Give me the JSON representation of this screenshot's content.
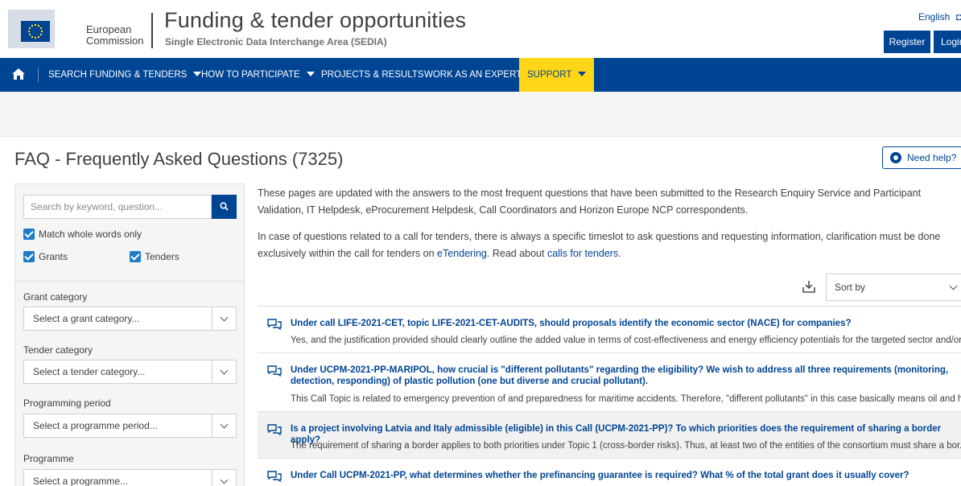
{
  "header": {
    "org_line1": "European",
    "org_line2": "Commission",
    "title": "Funding & tender opportunities",
    "subtitle": "Single Electronic Data Interchange Area (SEDIA)",
    "language": "English",
    "register_label": "Register",
    "login_label": "Login"
  },
  "nav": {
    "items": [
      {
        "label": "SEARCH FUNDING & TENDERS",
        "dropdown": true
      },
      {
        "label": "HOW TO PARTICIPATE",
        "dropdown": true
      },
      {
        "label": "PROJECTS & RESULTS",
        "dropdown": false
      },
      {
        "label": "WORK AS AN EXPERT",
        "dropdown": false
      },
      {
        "label": "SUPPORT",
        "dropdown": true,
        "highlight": "#ffd617"
      }
    ]
  },
  "page": {
    "title": "FAQ - Frequently Asked Questions (7325)",
    "need_help_label": "Need help?"
  },
  "sidebar": {
    "search_placeholder": "Search by keyword, question...",
    "match_whole_words_label": "Match whole words only",
    "grants_label": "Grants",
    "tenders_label": "Tenders",
    "filters": [
      {
        "label": "Grant category",
        "value": "Select a grant category..."
      },
      {
        "label": "Tender category",
        "value": "Select a tender category..."
      },
      {
        "label": "Programming period",
        "value": "Select a programme period..."
      },
      {
        "label": "Programme",
        "value": "Select a programme..."
      }
    ]
  },
  "intro": {
    "p1": "These pages are updated with the answers to the most frequent questions that have been submitted to the Research Enquiry Service and Participant Validation, IT Helpdesk, eProcurement Helpdesk, Call Coordinators and Horizon Europe NCP correspondents.",
    "p2_before": "In case of questions related to a call for tenders, there is always a specific timeslot to ask questions and requesting information, clarification must be done exclusively within the call for tenders on ",
    "p2_link1": "eTendering",
    "p2_middle": ". Read about ",
    "p2_link2": "calls for tenders",
    "p2_after": "."
  },
  "sort": {
    "label": "Sort by"
  },
  "faqs": [
    {
      "question": "Under call LIFE-2021-CET, topic LIFE-2021-CET-AUDITS, should proposals identify the economic sector (NACE) for companies?",
      "answer": "Yes, and the justification provided should clearly outline the added value in terms of cost-effectiveness and energy efficiency potentials for the targeted sector and/or ..."
    },
    {
      "question": "Under UCPM-2021-PP-MARIPOL, how crucial is \"different pollutants\" regarding the eligibility? We wish to address all three requirements (monitoring, detection, responding) of plastic pollution (one but diverse and crucial pollutant).",
      "answer": "This Call Topic is related to emergency prevention of and preparedness for maritime accidents. Therefore, \"different pollutants\" in this case basically means oil and h..."
    },
    {
      "question": "Is a project involving Latvia and Italy admissible (eligible) in this Call (UCPM-2021-PP)? To which priorities does the requirement of sharing a border apply?",
      "answer": "The requirement of sharing a border applies to both priorities under Topic 1 (cross-border risks). Thus, at least two of the entities of the consortium must share a bor..."
    },
    {
      "question": "Under Call UCPM-2021-PP, what determines whether the prefinancing guarantee is required? What % of the total grant does it usually cover?",
      "answer": ""
    }
  ]
}
